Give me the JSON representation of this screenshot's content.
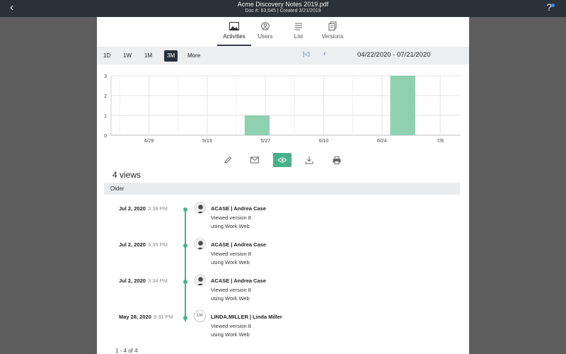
{
  "header": {
    "back_icon": "chevron-left-icon",
    "title": "Acme Discovery Notes 2019.pdf",
    "subtitle": "Doc #: 63,645 | Created 3/21/2019",
    "help_icon": "help-icon"
  },
  "tabs": [
    {
      "label": "Activities",
      "icon": "chart-image-icon",
      "active": true
    },
    {
      "label": "Users",
      "icon": "users-icon",
      "active": false
    },
    {
      "label": "List",
      "icon": "list-icon",
      "active": false
    },
    {
      "label": "Versions",
      "icon": "versions-icon",
      "active": false
    }
  ],
  "range": {
    "buttons": [
      "1D",
      "1W",
      "1M",
      "3M",
      "More"
    ],
    "active": "3M",
    "text": "04/22/2020 - 07/21/2020"
  },
  "chart_data": {
    "type": "bar",
    "categories": [
      "4/29",
      "5/13",
      "5/27",
      "6/10",
      "6/24",
      "7/8"
    ],
    "bars": [
      {
        "x_start": "5/22",
        "x_end": "5/28",
        "value": 1
      },
      {
        "x_start": "6/26",
        "x_end": "7/2",
        "value": 3
      }
    ],
    "yticks": [
      0,
      1,
      2,
      3
    ],
    "ylim": [
      0,
      3
    ],
    "bar_color": "#8fd0b1",
    "grid": true
  },
  "toolbar": [
    {
      "icon": "edit-icon",
      "active": false
    },
    {
      "icon": "mail-icon",
      "active": false
    },
    {
      "icon": "view-icon",
      "active": true
    },
    {
      "icon": "download-icon",
      "active": false
    },
    {
      "icon": "print-icon",
      "active": false
    }
  ],
  "summary": {
    "views": "4 views",
    "section": "Older"
  },
  "entries": [
    {
      "date": "Jul 2, 2020",
      "time": "3:38 PM",
      "user": "ACASE | Andrea Case",
      "action": "Viewed version 8",
      "via": "using Work Web",
      "avatar": "photo"
    },
    {
      "date": "Jul 2, 2020",
      "time": "3:35 PM",
      "user": "ACASE | Andrea Case",
      "action": "Viewed version 8",
      "via": "using Work Web",
      "avatar": "photo"
    },
    {
      "date": "Jul 2, 2020",
      "time": "3:34 PM",
      "user": "ACASE | Andrea Case",
      "action": "Viewed version 8",
      "via": "using Work Web",
      "avatar": "photo"
    },
    {
      "date": "May 28, 2020",
      "time": "9:31 PM",
      "user": "LINDA.MILLER | Linda Miller",
      "action": "Viewed version 8",
      "via": "using Work Web",
      "avatar": "LM"
    }
  ],
  "pager": "1 - 4 of 4",
  "colors": {
    "accent": "#4bb08c",
    "topbar": "#2b3139",
    "rangebar": "#eceef0"
  }
}
